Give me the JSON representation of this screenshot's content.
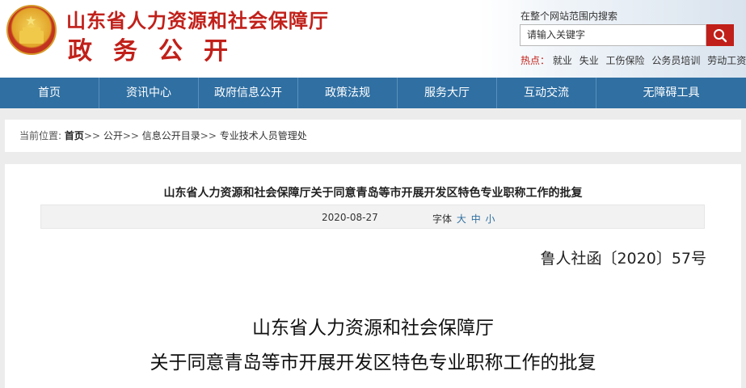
{
  "header": {
    "site_title": "山东省人力资源和社会保障厅",
    "site_subtitle": "政务公开",
    "search_label": "在整个网站范围内搜索",
    "search_placeholder": "请输入关键字",
    "hot_label": "热点：",
    "hot_keywords": [
      "就业",
      "失业",
      "工伤保险",
      "公务员培训",
      "劳动工资"
    ]
  },
  "nav": {
    "items": [
      "首页",
      "资讯中心",
      "政府信息公开",
      "政策法规",
      "服务大厅",
      "互动交流",
      "无障碍工具"
    ]
  },
  "breadcrumb": {
    "prefix": "当前位置:",
    "items": [
      "首页",
      "公开",
      "信息公开目录",
      "专业技术人员管理处"
    ],
    "separator": ">>"
  },
  "article": {
    "title": "山东省人力资源和社会保障厅关于同意青岛等市开展开发区特色专业职称工作的批复",
    "date": "2020-08-27",
    "font_label": "字体",
    "font_sizes": [
      "大",
      "中",
      "小"
    ],
    "doc_number": "鲁人社函〔2020〕57号",
    "heading_line1": "山东省人力资源和社会保障厅",
    "heading_line2": "关于同意青岛等市开展开发区特色专业职称工作的批复"
  },
  "colors": {
    "brand_red": "#c1201a",
    "nav_blue": "#2f6fa2"
  }
}
